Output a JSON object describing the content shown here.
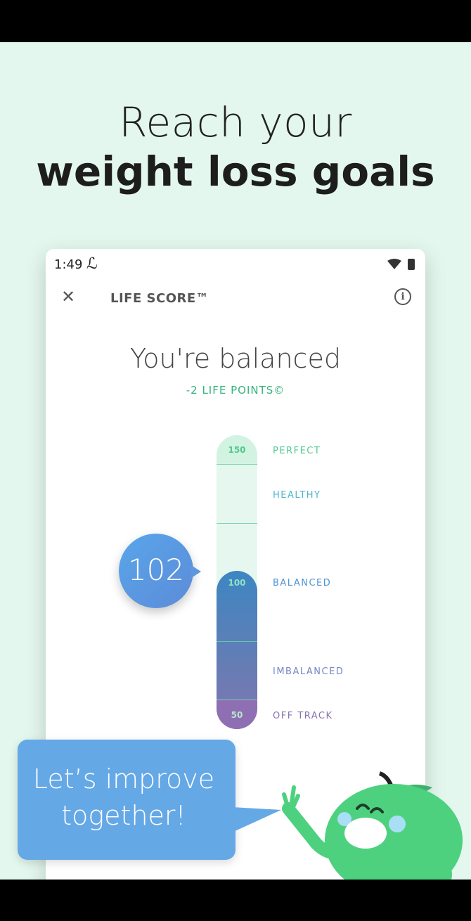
{
  "headline": {
    "line1": "Reach your",
    "line2": "weight loss goals"
  },
  "device": {
    "status_time": "1:49",
    "status_icon": "ℒ",
    "app_title": "LIFE SCORE™",
    "state_title": "You're balanced",
    "life_points": "-2 LIFE POINTS©"
  },
  "gauge": {
    "current_score": "102",
    "values": {
      "top": "150",
      "mid": "100",
      "bottom": "50"
    },
    "labels": {
      "perfect": "PERFECT",
      "healthy": "HEALTHY",
      "balanced": "BALANCED",
      "imbalanced": "IMBALANCED",
      "off_track": "OFF TRACK"
    }
  },
  "promo": {
    "line1": "Let’s improve",
    "line2": "together!"
  },
  "colors": {
    "accent": "#35b37e",
    "bubble": "#5d9ce3",
    "gauge_fill": "#6a7cb3",
    "background": "#e3f7ee"
  }
}
